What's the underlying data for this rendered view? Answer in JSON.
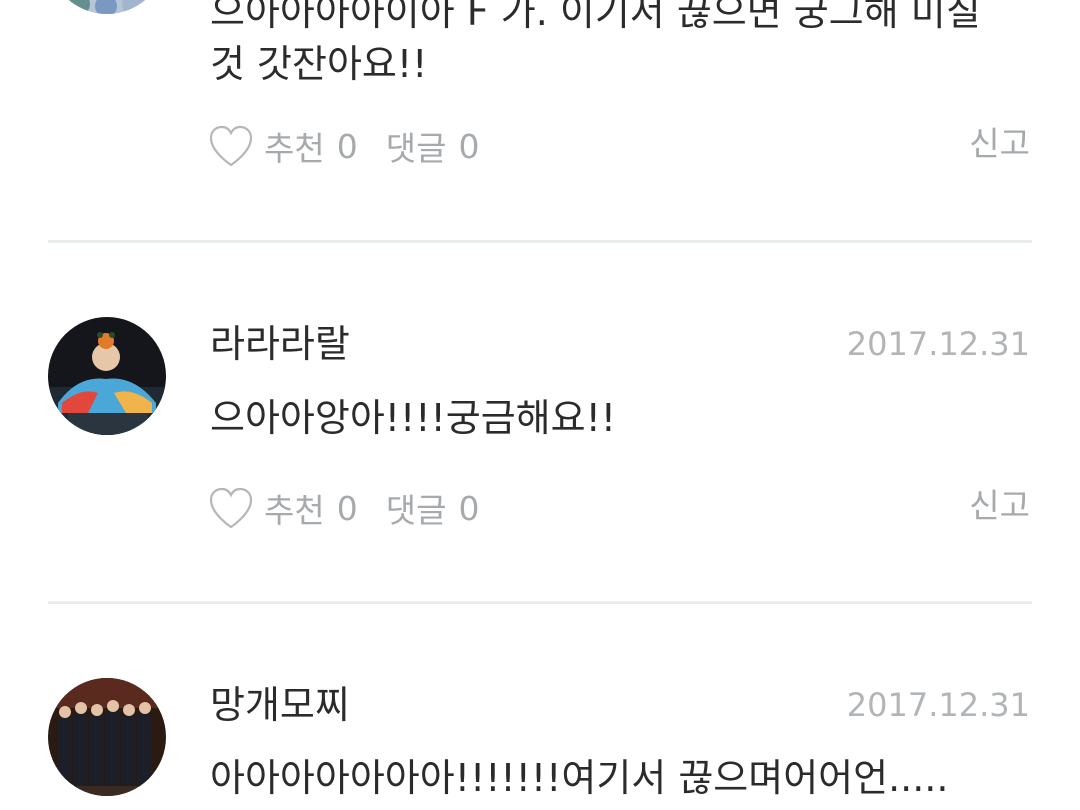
{
  "comments": [
    {
      "username": "",
      "date": "",
      "text_lines": [
        "으아아아아이아 F 가. 이기서 끊으면 궁그해 미칠",
        "것 갓잔아요!!"
      ],
      "like_label": "추천",
      "like_count": "0",
      "reply_label": "댓글",
      "reply_count": "0",
      "report_label": "신고"
    },
    {
      "username": "라라라랄",
      "date": "2017.12.31",
      "text_lines": [
        "으아아앙아!!!!궁금해요!!"
      ],
      "like_label": "추천",
      "like_count": "0",
      "reply_label": "댓글",
      "reply_count": "0",
      "report_label": "신고"
    },
    {
      "username": "망개모찌",
      "date": "2017.12.31",
      "text_lines": [
        "아아아아아아아!!!!!!!여기서 끊으며어어언....."
      ],
      "like_label": "추천",
      "like_count": "0",
      "reply_label": "댓글",
      "reply_count": "0",
      "report_label": "신고"
    }
  ],
  "colors": {
    "text": "#2b2b2b",
    "muted": "#a6aaad",
    "date": "#b2b5b8",
    "divider": "#e8eded"
  }
}
